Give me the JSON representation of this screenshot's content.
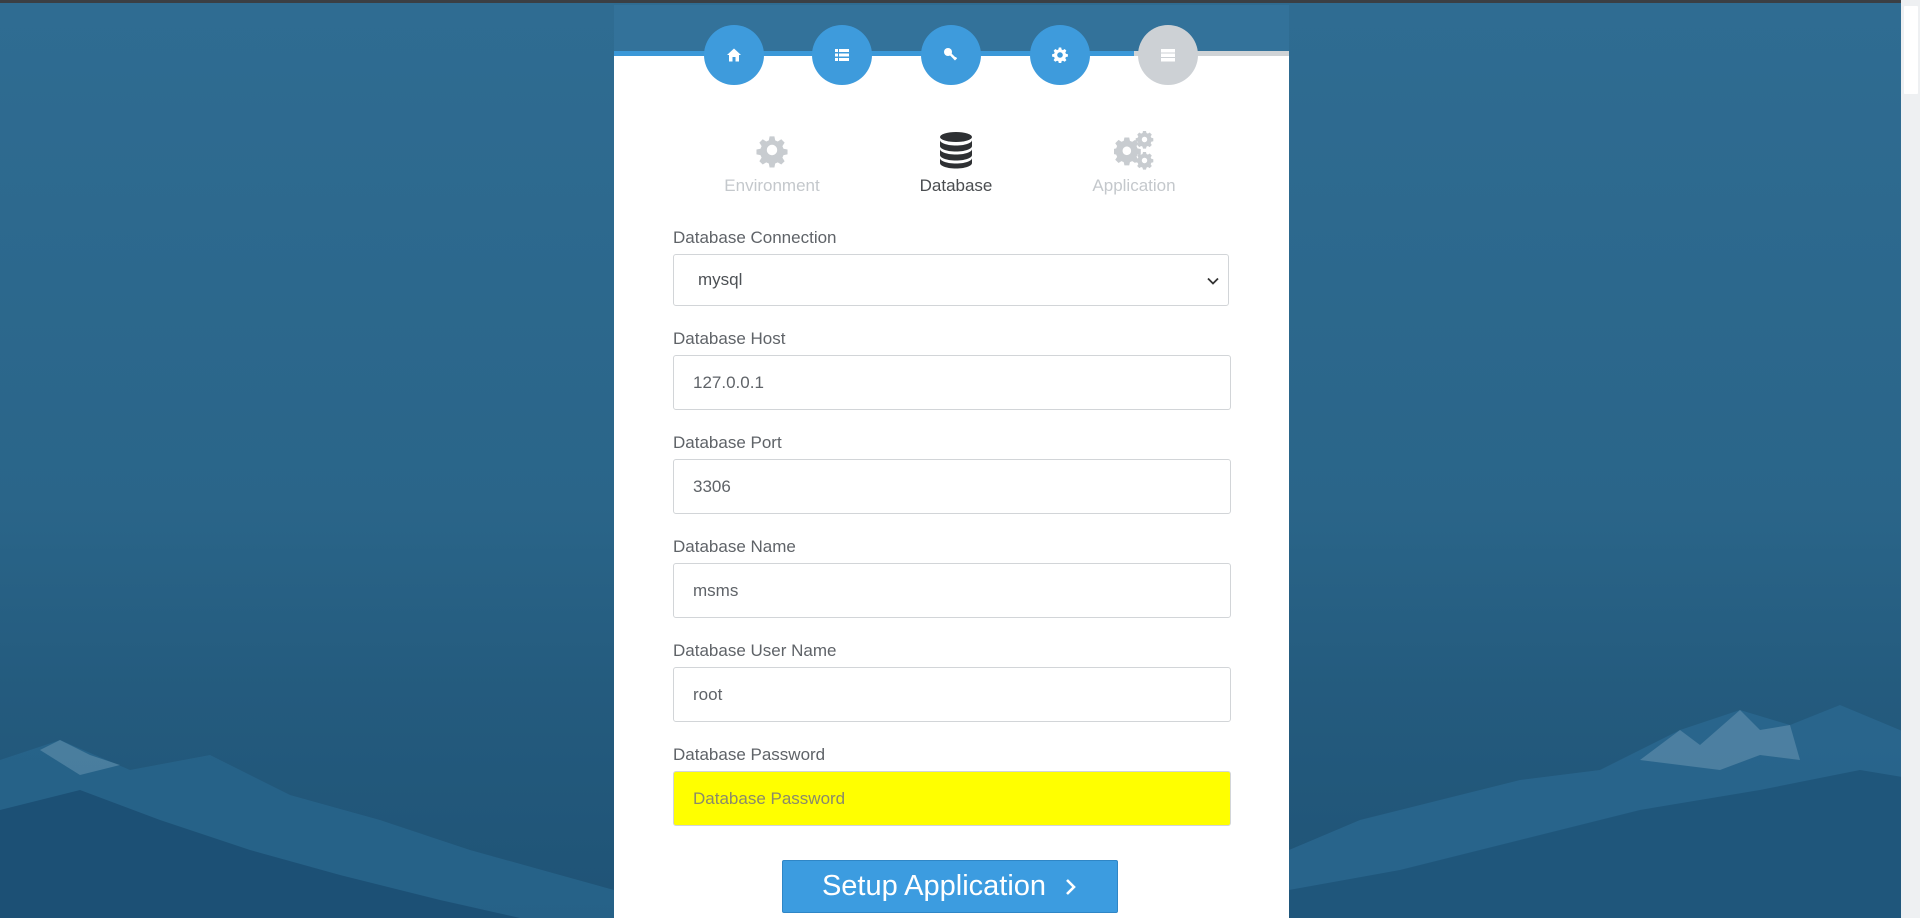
{
  "colors": {
    "accent": "#3e9bdc",
    "header": "#33729a",
    "inactive": "#cdd1d5",
    "highlight": "#ffff00"
  },
  "steps": [
    {
      "icon": "home-icon",
      "state": "done"
    },
    {
      "icon": "list-icon",
      "state": "done"
    },
    {
      "icon": "key-icon",
      "state": "done"
    },
    {
      "icon": "gear-icon",
      "state": "done"
    },
    {
      "icon": "server-icon",
      "state": "pending"
    }
  ],
  "tabs": {
    "environment": {
      "label": "Environment",
      "icon": "gear-icon"
    },
    "database": {
      "label": "Database",
      "icon": "database-icon",
      "active": true
    },
    "application": {
      "label": "Application",
      "icon": "gears-icon"
    }
  },
  "form": {
    "connection": {
      "label": "Database Connection",
      "value": "mysql"
    },
    "host": {
      "label": "Database Host",
      "value": "127.0.0.1"
    },
    "port": {
      "label": "Database Port",
      "value": "3306"
    },
    "name": {
      "label": "Database Name",
      "value": "msms"
    },
    "username": {
      "label": "Database User Name",
      "value": "root"
    },
    "password": {
      "label": "Database Password",
      "value": "",
      "placeholder": "Database Password"
    }
  },
  "submit": {
    "label": "Setup Application"
  }
}
